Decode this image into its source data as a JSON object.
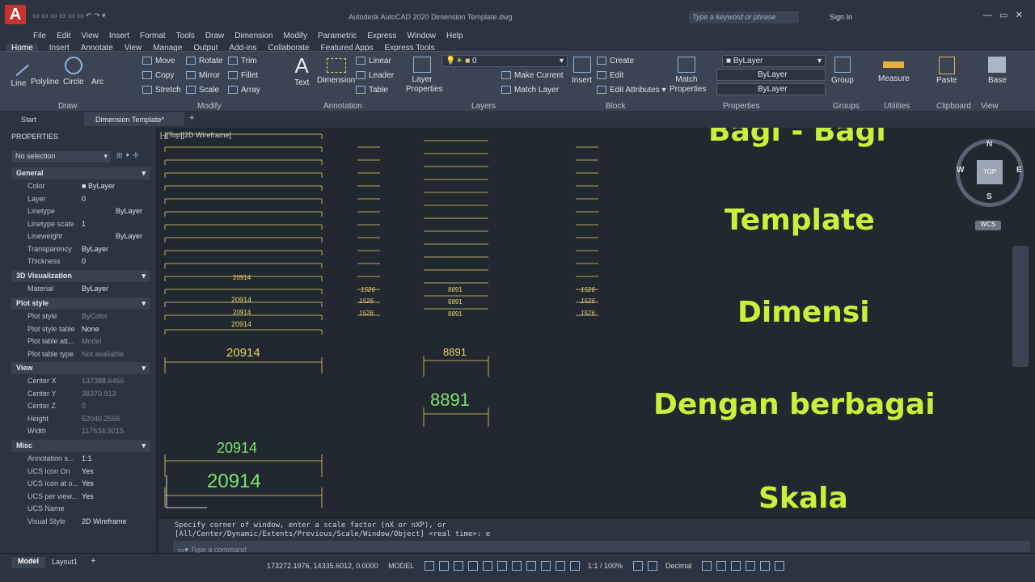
{
  "app": {
    "title": "Autodesk AutoCAD 2020   Dimension Template.dwg",
    "search_placeholder": "Type a keyword or phrase",
    "signin": "Sign In"
  },
  "menu": [
    "File",
    "Edit",
    "View",
    "Insert",
    "Format",
    "Tools",
    "Draw",
    "Dimension",
    "Modify",
    "Parametric",
    "Express",
    "Window",
    "Help"
  ],
  "ribbon_tabs": [
    "Home",
    "Insert",
    "Annotate",
    "View",
    "Manage",
    "Output",
    "Add-ins",
    "Collaborate",
    "Featured Apps",
    "Express Tools"
  ],
  "ribbon": {
    "draw": {
      "label": "Draw",
      "line": "Line",
      "polyline": "Polyline",
      "circle": "Circle",
      "arc": "Arc"
    },
    "modify": {
      "label": "Modify",
      "move": "Move",
      "rotate": "Rotate",
      "trim": "Trim",
      "copy": "Copy",
      "mirror": "Mirror",
      "fillet": "Fillet",
      "stretch": "Stretch",
      "scale": "Scale",
      "array": "Array"
    },
    "annotation": {
      "label": "Annotation",
      "text": "Text",
      "dimension": "Dimension",
      "linear": "Linear",
      "leader": "Leader",
      "table": "Table"
    },
    "layers": {
      "label": "Layers",
      "layer_properties": "Layer Properties",
      "current_layer": "0",
      "make_current": "Make Current",
      "match_layer": "Match Layer"
    },
    "block": {
      "label": "Block",
      "insert": "Insert",
      "create": "Create",
      "edit": "Edit",
      "edit_attributes": "Edit Attributes"
    },
    "properties": {
      "label": "Properties",
      "match_properties": "Match Properties",
      "color": "ByLayer",
      "linetype": "ByLayer",
      "lineweight": "ByLayer"
    },
    "groups": {
      "label": "Groups",
      "group": "Group"
    },
    "utilities": {
      "label": "Utilities",
      "measure": "Measure"
    },
    "clipboard": {
      "label": "Clipboard",
      "paste": "Paste"
    },
    "view": {
      "label": "View",
      "base": "Base"
    }
  },
  "doc_tabs": {
    "start": "Start",
    "current": "Dimension Template*"
  },
  "properties_panel": {
    "title": "PROPERTIES",
    "selection": "No selection",
    "general": {
      "head": "General",
      "rows": [
        [
          "Color",
          "ByLayer"
        ],
        [
          "Layer",
          "0"
        ],
        [
          "Linetype",
          "ByLayer"
        ],
        [
          "Linetype scale",
          "1"
        ],
        [
          "Lineweight",
          "ByLayer"
        ],
        [
          "Transparency",
          "ByLayer"
        ],
        [
          "Thickness",
          "0"
        ]
      ]
    },
    "viz": {
      "head": "3D Visualization",
      "rows": [
        [
          "Material",
          "ByLayer"
        ]
      ]
    },
    "plot": {
      "head": "Plot style",
      "rows": [
        [
          "Plot style",
          "ByColor"
        ],
        [
          "Plot style table",
          "None"
        ],
        [
          "Plot table att...",
          "Model"
        ],
        [
          "Plot table type",
          "Not available"
        ]
      ]
    },
    "view": {
      "head": "View",
      "rows": [
        [
          "Center X",
          "137388.6466"
        ],
        [
          "Center Y",
          "38370.913"
        ],
        [
          "Center Z",
          "0"
        ],
        [
          "Height",
          "52040.2566"
        ],
        [
          "Width",
          "117634.9215"
        ]
      ]
    },
    "misc": {
      "head": "Misc",
      "rows": [
        [
          "Annotation s...",
          "1:1"
        ],
        [
          "UCS icon On",
          "Yes"
        ],
        [
          "UCS icon at o...",
          "Yes"
        ],
        [
          "UCS per view...",
          "Yes"
        ],
        [
          "UCS Name",
          ""
        ],
        [
          "Visual Style",
          "2D Wireframe"
        ]
      ]
    }
  },
  "viewport_label": "[-][Top][2D Wireframe]",
  "overlay": [
    "Bagi - Bagi",
    "Template",
    "Dimensi",
    "Dengan berbagai",
    "Skala"
  ],
  "viewcube": {
    "n": "N",
    "s": "S",
    "e": "E",
    "w": "W",
    "top": "TOP",
    "wcs": "WCS"
  },
  "dims": {
    "a1": "20914",
    "a2": "20914",
    "a3": "20914",
    "a_big1": "20914",
    "a_big2": "20914",
    "a_big3": "20914",
    "b1": "8891",
    "b2": "8891",
    "b3": "8891",
    "b_big1": "8891",
    "b_big2": "8891",
    "c1": "1526",
    "c2": "1526",
    "c3": "1526",
    "d1": "1526",
    "d2": "1526",
    "d3": "1526"
  },
  "command": {
    "line1": "Specify corner of window, enter a scale factor (nX or nXP), or",
    "line2": "[All/Center/Dynamic/Extents/Previous/Scale/Window/Object] <real time>: e",
    "placeholder": "Type a command"
  },
  "status": {
    "model_tab": "Model",
    "layout1": "Layout1",
    "coords": "173272.1976, 14335.6012, 0.0000",
    "model": "MODEL",
    "scale": "1:1 / 100%",
    "units": "Decimal"
  },
  "colors": {
    "dim_green": "#7ee36b",
    "overlay_lime": "#c6f23a",
    "dim_yellow": "#e8d36a"
  }
}
